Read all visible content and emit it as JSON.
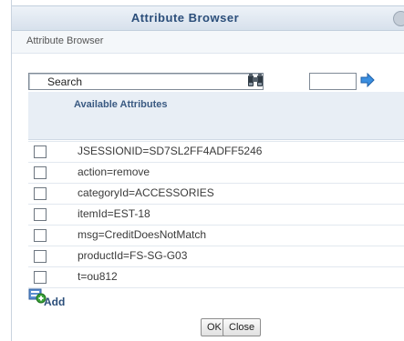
{
  "dialog": {
    "title": "Attribute Browser",
    "subtitle": "Attribute Browser"
  },
  "search": {
    "label": "Search",
    "page_value": ""
  },
  "table": {
    "column_header": "Available Attributes",
    "rows": [
      "JSESSIONID=SD7SL2FF4ADFF5246",
      "action=remove",
      "categoryId=ACCESSORIES",
      "itemId=EST-18",
      "msg=CreditDoesNotMatch",
      "productId=FS-SG-G03",
      "t=ou812"
    ]
  },
  "actions": {
    "add_label": "Add",
    "ok_label": "OK",
    "close_label": "Close"
  },
  "icons": {
    "help": "help-icon",
    "search": "binoculars-icon",
    "go": "arrow-right-icon",
    "add": "add-icon"
  },
  "colors": {
    "title_text": "#2b4e7a",
    "header_bg": "#e8eef5",
    "go_arrow": "#3b8fe0"
  }
}
